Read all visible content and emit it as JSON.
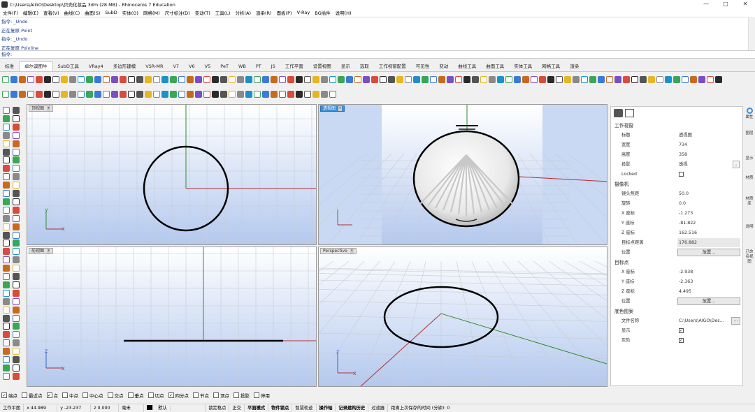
{
  "window": {
    "title": "C:\\Users\\AIGO\\Desktop\\贝壳化妆品.3dm (28 MB) - Rhinoceros 7 Education",
    "controls": [
      "—",
      "□",
      "✕"
    ]
  },
  "menu": [
    "文件(F)",
    "编辑(E)",
    "查看(V)",
    "曲线(C)",
    "曲面(S)",
    "SubD",
    "实体(O)",
    "网格(M)",
    "尺寸标注(D)",
    "变动(T)",
    "工具(L)",
    "分析(A)",
    "渲染(R)",
    "面板(P)",
    "V-Ray",
    "BG插件",
    "说明(H)"
  ],
  "command_history": [
    "指令: _Undo",
    "正在复原 Point",
    "指令: _Undo",
    "正在复原 Polyline"
  ],
  "command_prompt": "指令:",
  "tabs": [
    "标准",
    "卓尔谟图牛",
    "SubD工具",
    "VRay4",
    "多边形建模",
    "VSR-MR",
    "V7",
    "V6",
    "V5",
    "PeT",
    "WB",
    "PT",
    "JS",
    "工作平面",
    "设置视图",
    "显示",
    "选取",
    "工作视窗配置",
    "可见性",
    "变动",
    "曲线工具",
    "曲面工具",
    "实体工具",
    "网格工具",
    "渲染"
  ],
  "active_tab_index": 1,
  "viewports": {
    "top": {
      "label": "顶视图",
      "axis_x": "x",
      "axis_y": "y"
    },
    "persp_ortho": {
      "label": "透视图"
    },
    "front": {
      "label": "前视图",
      "axis_x": "x",
      "axis_y": "z"
    },
    "perspective": {
      "label": "Perspective",
      "axis_x": "x",
      "axis_y": "z"
    }
  },
  "properties": {
    "section_viewport": "工作视窗",
    "title_label": "标题",
    "title_value": "透视图",
    "width_label": "宽度",
    "width_value": "734",
    "height_label": "高度",
    "height_value": "358",
    "projection_label": "投影",
    "projection_value": "透视",
    "locked_label": "Locked",
    "section_camera": "摄像机",
    "lens_label": "镜头焦距",
    "lens_value": "50.0",
    "rotation_label": "旋转",
    "rotation_value": "0.0",
    "cx_label": "X 座标",
    "cx_value": "-1.273",
    "cy_label": "Y 座标",
    "cy_value": "-81.822",
    "cz_label": "Z 座标",
    "cz_value": "162.516",
    "target_dist_label": "目标点距离",
    "target_dist_value": "176.882",
    "position_label": "位置",
    "place_button": "放置...",
    "section_target": "目标点",
    "tx_label": "X 座标",
    "tx_value": "-2.938",
    "ty_label": "Y 座标",
    "ty_value": "-2.363",
    "tz_label": "Z 座标",
    "tz_value": "4.495",
    "target_position_label": "位置",
    "target_place_button": "放置...",
    "section_bg": "底色图案",
    "filename_label": "文件名称",
    "filename_value": "C:\\Users\\AIGO\\Des...",
    "browse_button": "...",
    "show_label": "显示",
    "grey_label": "灰阶"
  },
  "side_tabs": [
    "属性",
    "图层",
    "显示",
    "材质",
    "材质库",
    "说明",
    "已命名视图"
  ],
  "osnaps": [
    {
      "label": "端点",
      "checked": true
    },
    {
      "label": "最近点",
      "checked": false
    },
    {
      "label": "点",
      "checked": true
    },
    {
      "label": "中点",
      "checked": false
    },
    {
      "label": "中心点",
      "checked": false
    },
    {
      "label": "交点",
      "checked": false
    },
    {
      "label": "垂点",
      "checked": false
    },
    {
      "label": "切点",
      "checked": false
    },
    {
      "label": "四分点",
      "checked": true
    },
    {
      "label": "节点",
      "checked": false
    },
    {
      "label": "顶点",
      "checked": false
    },
    {
      "label": "投影",
      "checked": false
    },
    {
      "label": "停用",
      "checked": false
    }
  ],
  "status": {
    "cplane": "工作平面",
    "x": "x 44.989",
    "y": "y -23.237",
    "z": "z 0.000",
    "units": "毫米",
    "layer": "默认",
    "grid_snap": "锁定格点",
    "ortho": "正交",
    "planar": "平面模式",
    "osnap": "物件锁点",
    "smart_track": "智慧轨迹",
    "gumball": "操作轴",
    "history": "记录建构历史",
    "filter": "过滤器",
    "autosave": "距离上次保存的时间 (分钟): 0"
  },
  "colors": {
    "accent": "#3a8fd8",
    "x_axis": "#b03030",
    "y_axis": "#2e8b2e",
    "grid": "#c8ccd2",
    "vp_top": "#ffffff",
    "vp_bottom": "#b3c8ee"
  }
}
